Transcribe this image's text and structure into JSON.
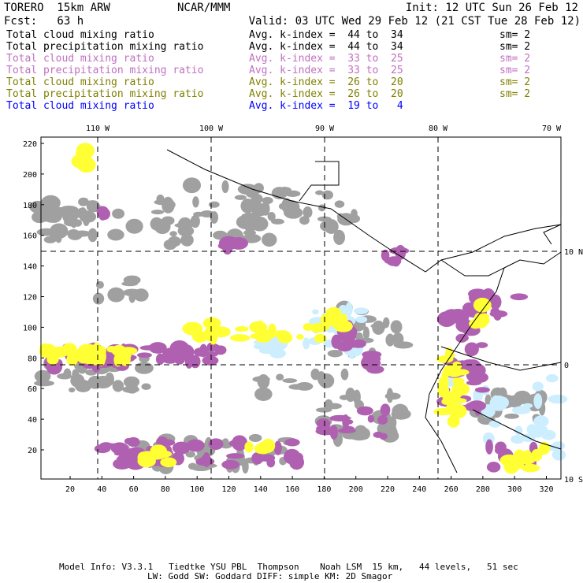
{
  "header": {
    "model": "TORERO  15km ARW",
    "org": "NCAR/MMM",
    "init": "Init: 12 UTC Sun 26 Feb 12",
    "fcst": "Fcst:   63 h",
    "valid": "Valid: 03 UTC Wed 29 Feb 12 (21 CST Tue 28 Feb 12)"
  },
  "legend": [
    {
      "field": "Total cloud mixing ratio",
      "range": "Avg. k-index =  44 to  34",
      "sm": "sm= 2",
      "color": "#000000"
    },
    {
      "field": "Total precipitation mixing ratio",
      "range": "Avg. k-index =  44 to  34",
      "sm": "sm= 2",
      "color": "#000000"
    },
    {
      "field": "Total cloud mixing ratio",
      "range": "Avg. k-index =  33 to  25",
      "sm": "sm= 2",
      "color": "#c070c0"
    },
    {
      "field": "Total precipitation mixing ratio",
      "range": "Avg. k-index =  33 to  25",
      "sm": "sm= 2",
      "color": "#c070c0"
    },
    {
      "field": "Total cloud mixing ratio",
      "range": "Avg. k-index =  26 to  20",
      "sm": "sm= 2",
      "color": "#808000"
    },
    {
      "field": "Total precipitation mixing ratio",
      "range": "Avg. k-index =  26 to  20",
      "sm": "sm= 2",
      "color": "#808000"
    },
    {
      "field": "Total cloud mixing ratio",
      "range": "Avg. k-index =  19 to   4",
      "color": "#0000ff"
    }
  ],
  "map": {
    "lon_labels": [
      "110 W",
      "100 W",
      "90 W",
      "80 W",
      "70 W"
    ],
    "lat_labels": [
      "10 N",
      "0",
      "10 S"
    ],
    "x_ticks": [
      "20",
      "40",
      "60",
      "80",
      "100",
      "120",
      "140",
      "160",
      "180",
      "200",
      "220",
      "240",
      "260",
      "280",
      "300",
      "320"
    ],
    "y_ticks": [
      "20",
      "40",
      "60",
      "80",
      "100",
      "120",
      "140",
      "160",
      "180",
      "200",
      "220"
    ],
    "colors": {
      "gray": "#a0a0a0",
      "purple": "#b060b0",
      "yellow": "#ffff33",
      "lightblue": "#cceeff"
    }
  },
  "footer": {
    "line1": "Model Info: V3.3.1   Tiedtke YSU PBL  Thompson    Noah LSM  15 km,   44 levels,   51 sec",
    "line2": "LW: Godd SW: Goddard DIFF: simple KM: 2D Smagor"
  }
}
